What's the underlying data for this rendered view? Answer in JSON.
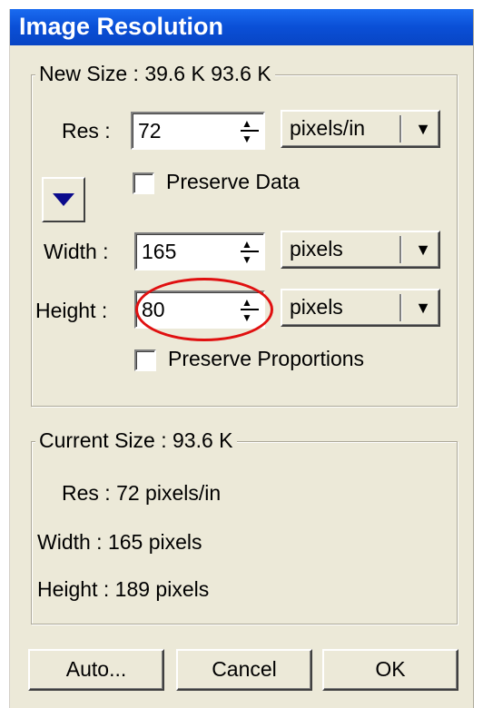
{
  "dialog": {
    "title": "Image Resolution"
  },
  "new_size": {
    "legend": "New Size :   39.6 K 93.6 K",
    "res_label": "Res :",
    "res_value": "72",
    "res_unit": "pixels/in",
    "preserve_data_label": "Preserve Data",
    "preserve_data_checked": false,
    "width_label": "Width :",
    "width_value": "165",
    "width_unit": "pixels",
    "height_label": "Height :",
    "height_value": "80",
    "height_unit": "pixels",
    "preserve_proportions_label": "Preserve Proportions",
    "preserve_proportions_checked": false
  },
  "current_size": {
    "legend": "Current Size :   93.6 K",
    "res_text": "Res : 72 pixels/in",
    "width_text": "Width : 165 pixels",
    "height_text": "Height : 189 pixels"
  },
  "buttons": {
    "auto_label": "Auto...",
    "cancel_label": "Cancel",
    "ok_label": "OK"
  },
  "colors": {
    "title_bar": "#0a4fd6",
    "dialog_bg": "#ece9d8",
    "annotation_circle": "#e01010",
    "toggle_triangle": "#0b0b8c"
  },
  "icons": {
    "toggle": "triangle-down-icon",
    "spin": "spinner-arrows-icon",
    "dropdown": "chevron-down-icon"
  }
}
